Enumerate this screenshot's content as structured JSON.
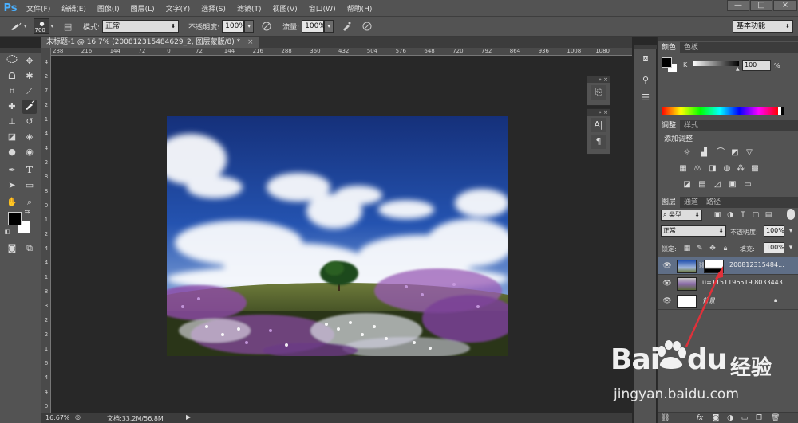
{
  "app": {
    "logo": "Ps"
  },
  "menu": [
    "文件(F)",
    "编辑(E)",
    "图像(I)",
    "图层(L)",
    "文字(Y)",
    "选择(S)",
    "滤镜(T)",
    "视图(V)",
    "窗口(W)",
    "帮助(H)"
  ],
  "window_controls": {
    "minimize": "—",
    "maximize": "□",
    "close": "×"
  },
  "options": {
    "brush_size": "700",
    "mode_label": "模式:",
    "mode_value": "正常",
    "opacity_label": "不透明度:",
    "opacity_value": "100%",
    "flow_label": "流量:",
    "flow_value": "100%",
    "workspace": "基本功能"
  },
  "document": {
    "tab_title": "未标题-1 @ 16.7% (2008123154846​29_2, 图层蒙版/8) *",
    "tab_close": "×",
    "zoom": "16.67%",
    "doc_info": "文档:33.2M/56.8M"
  },
  "ruler_h": [
    "288",
    "216",
    "144",
    "72",
    "0",
    "72",
    "144",
    "216",
    "288",
    "360",
    "432",
    "504",
    "576",
    "648",
    "720",
    "792",
    "864",
    "936",
    "1008",
    "1080"
  ],
  "ruler_v": [
    "4",
    "2",
    "7",
    "2",
    "1",
    "4",
    "4",
    "2",
    "8",
    "8",
    "0",
    "1",
    "2",
    "4",
    "4",
    "1",
    "8",
    "3",
    "2",
    "2",
    "1",
    "6",
    "4",
    "4",
    "0"
  ],
  "panels": {
    "color": {
      "tabs": [
        "颜色",
        "色板"
      ],
      "channel": "K",
      "value": "100",
      "unit": "%"
    },
    "adjustments": {
      "tabs": [
        "调整",
        "样式"
      ],
      "title": "添加调整"
    },
    "layers": {
      "tabs": [
        "图层",
        "通道",
        "路径"
      ],
      "filter_label": "类型",
      "blend_mode": "正常",
      "opacity_label": "不透明度:",
      "opacity_value": "100%",
      "lock_label": "锁定:",
      "fill_label": "填充:",
      "fill_value": "100%",
      "items": [
        {
          "name": "200812315484...",
          "selected": true
        },
        {
          "name": "u=1151196519,8033443...",
          "selected": false
        },
        {
          "name": "背景",
          "selected": false
        }
      ]
    }
  },
  "watermark": {
    "brand": "Bai",
    "brand2": "du",
    "cn": "经验",
    "url": "jingyan.baidu.com"
  },
  "colors": {
    "accent": "#4ab0ff",
    "selected_layer": "#5f6e86",
    "arrow": "#e0313a"
  }
}
